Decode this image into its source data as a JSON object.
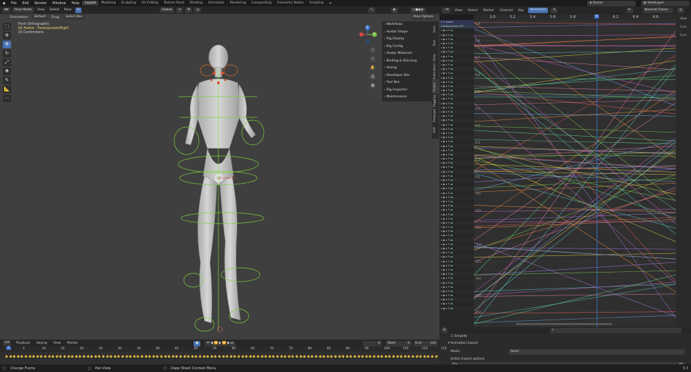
{
  "topbar": {
    "menus": [
      "File",
      "Edit",
      "Render",
      "Window",
      "Help"
    ],
    "workspaces": [
      "Layout",
      "Modeling",
      "Sculpting",
      "UV Editing",
      "Texture Paint",
      "Shading",
      "Animation",
      "Rendering",
      "Compositing",
      "Geometry Nodes",
      "Scripting"
    ],
    "active_workspace": "Layout",
    "scene": "Scene",
    "view_layer": "ViewLayer"
  },
  "viewport": {
    "mode": "Pose Mode",
    "menus": [
      "View",
      "Select",
      "Pose"
    ],
    "transform_space": "Global",
    "orientation_label": "Orientation:",
    "orientation_value": "Default",
    "drag_label": "Drag:",
    "drag_value": "Select Box",
    "pose_options": "Pose Options",
    "view_name": "Front Orthographic",
    "object_info": "(6) Avatar : FaceLipLowerRight",
    "scale_info": "10 Centimeters",
    "axis": {
      "y": "Y",
      "z": "Z"
    },
    "side_panel": [
      "Workflows",
      "Avatar Shape",
      "Rig Display",
      "Rig Config",
      "Avatar Materials",
      "Binding & Skinning",
      "Posing",
      "Developer Kits",
      "Tool Box",
      "Rig Inspector",
      "Maintenance"
    ],
    "side_tabs": [
      "Item",
      "Tool",
      "View",
      "Animation",
      "Avatar",
      "Rigging",
      "Retarget",
      "ARP"
    ]
  },
  "graph_editor": {
    "menus": [
      "View",
      "Select",
      "Marker",
      "Channel",
      "Key"
    ],
    "normalize": "Normalize",
    "snap": "Nearest Frame",
    "ruler": [
      "4.8",
      "5.0",
      "5.2",
      "5.4",
      "5.6",
      "5.8",
      "6",
      "6.2",
      "6.4",
      "6.6",
      "6.8"
    ],
    "current_frame": "6",
    "y_labels": [
      "0.9",
      "0.8",
      "0.7",
      "0.6",
      "0.5",
      "0.4",
      "0.3",
      "0.2",
      "0.1",
      "0.0",
      "-0.1",
      "-0.2",
      "-0.3",
      "-0.4",
      "-0.5",
      "-0.6",
      "-0.7",
      "-0.8"
    ],
    "channel_top": "Avatar",
    "channel_action": "AvatarAction.002",
    "right_tabs": [
      "View",
      "Curv",
      "Curv"
    ]
  },
  "properties": {
    "simplify": "Simplify",
    "section": "Animation Export",
    "mode_label": "Mode:",
    "mode_value": "Anim",
    "options_label": "Action Export options",
    "fps_label": "fps",
    "fps_value": "25"
  },
  "timeline": {
    "menus": [
      "Playback",
      "Keying",
      "View",
      "Marker"
    ],
    "current": "6",
    "start_label": "Start",
    "start": "0",
    "end_label": "End",
    "end": "120",
    "ticks": [
      "5",
      "10",
      "15",
      "20",
      "25",
      "30",
      "35",
      "40",
      "45",
      "50",
      "55",
      "60",
      "65",
      "70",
      "75",
      "80",
      "85",
      "90",
      "95",
      "100",
      "105",
      "110",
      "115"
    ],
    "cursor_label": "6"
  },
  "statusbar": {
    "left": "Change Frame",
    "mid": "Pan View",
    "right": "Dope Sheet Context Menu",
    "version": "3.3"
  },
  "colors": {
    "accent": "#4772b3",
    "rig_green": "#7fd33a",
    "frame_blue": "#3a6cc4"
  }
}
